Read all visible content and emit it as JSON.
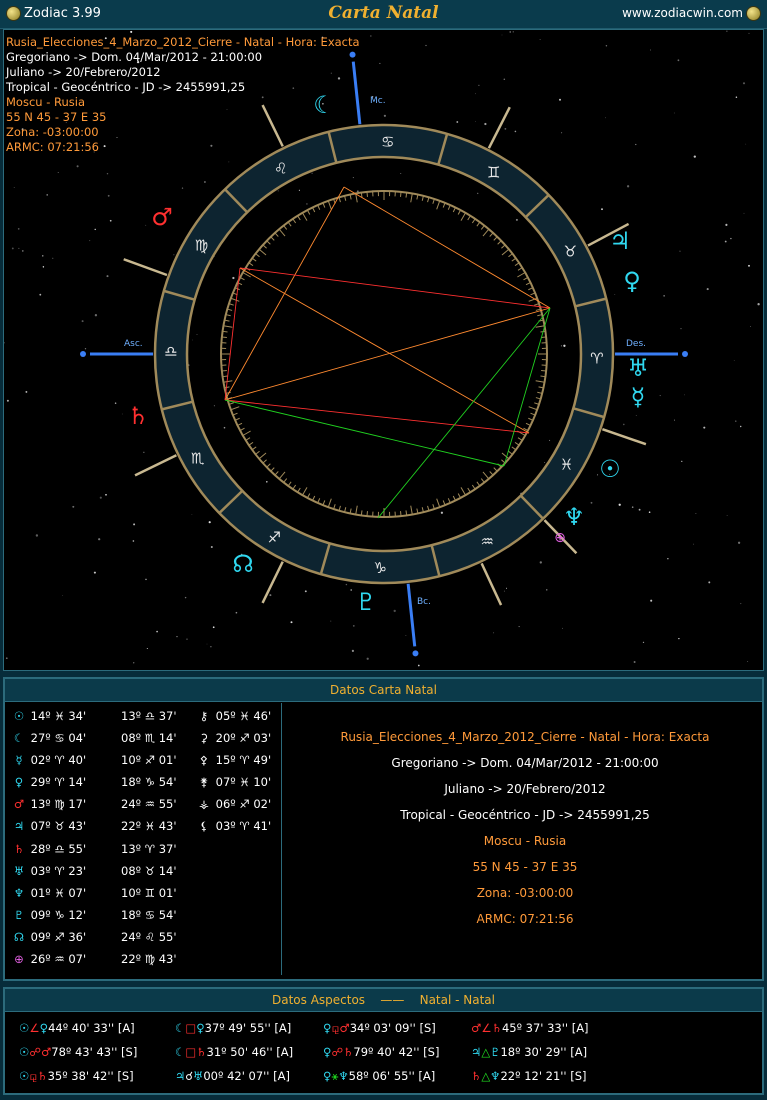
{
  "titlebar": {
    "app_name": "Zodiac 3.99",
    "title": "Carta Natal",
    "website": "www.zodiacwin.com"
  },
  "chart_info": {
    "lines": [
      {
        "text": "Rusia_Elecciones_4_Marzo_2012_Cierre - Natal - Hora: Exacta",
        "color": "#ff9a3a"
      },
      {
        "text": "Gregoriano -> Dom. 04/Mar/2012 - 21:00:00",
        "color": "#ffffff"
      },
      {
        "text": "Juliano -> 20/Febrero/2012",
        "color": "#ffffff"
      },
      {
        "text": "Tropical - Geocéntrico - JD -> 2455991,25",
        "color": "#ffffff"
      },
      {
        "text": "Moscu - Rusia",
        "color": "#ff9a3a"
      },
      {
        "text": "55 N 45 - 37 E 35",
        "color": "#ff9a3a"
      },
      {
        "text": "Zona: -03:00:00",
        "color": "#ff9a3a"
      },
      {
        "text": "ARMC: 07:21:56",
        "color": "#ff9a3a"
      }
    ]
  },
  "wheel": {
    "axis_labels": {
      "asc": "Asc.",
      "des": "Des.",
      "mc": "Mc.",
      "ic": "Bc."
    },
    "signs": [
      {
        "name": "aries",
        "glyph": "♈"
      },
      {
        "name": "taurus",
        "glyph": "♉"
      },
      {
        "name": "gemini",
        "glyph": "♊"
      },
      {
        "name": "cancer",
        "glyph": "♋"
      },
      {
        "name": "leo",
        "glyph": "♌"
      },
      {
        "name": "virgo",
        "glyph": "♍"
      },
      {
        "name": "libra",
        "glyph": "♎"
      },
      {
        "name": "scorpio",
        "glyph": "♏"
      },
      {
        "name": "sagittarius",
        "glyph": "♐"
      },
      {
        "name": "capricorn",
        "glyph": "♑"
      },
      {
        "name": "aquarius",
        "glyph": "♒"
      },
      {
        "name": "pisces",
        "glyph": "♓"
      }
    ],
    "planets": [
      {
        "name": "moon",
        "glyph": "☾",
        "color": "#30d8f0"
      },
      {
        "name": "jupiter",
        "glyph": "♃",
        "color": "#30d8f0"
      },
      {
        "name": "venus",
        "glyph": "♀",
        "color": "#30d8f0"
      },
      {
        "name": "uranus",
        "glyph": "♅",
        "color": "#30d8f0"
      },
      {
        "name": "mercury",
        "glyph": "☿",
        "color": "#30d8f0"
      },
      {
        "name": "sun",
        "glyph": "☉",
        "color": "#30d8f0"
      },
      {
        "name": "neptune",
        "glyph": "♆",
        "color": "#30d8f0"
      },
      {
        "name": "part-of-fortune",
        "glyph": "⊕",
        "color": "#e060e0"
      },
      {
        "name": "pluto",
        "glyph": "♇",
        "color": "#30d8f0"
      },
      {
        "name": "north-node",
        "glyph": "☊",
        "color": "#30d8f0"
      },
      {
        "name": "saturn",
        "glyph": "♄",
        "color": "#ff3030"
      },
      {
        "name": "mars",
        "glyph": "♂",
        "color": "#ff3030"
      }
    ]
  },
  "datos_carta": {
    "title": "Datos Carta Natal",
    "positions": [
      [
        {
          "g": "☉",
          "c": "#30d8f0",
          "deg": "14º",
          "s": "♓",
          "min": "34'"
        },
        {
          "g": "",
          "c": "",
          "deg": "13º",
          "s": "♎",
          "min": "37'"
        },
        {
          "g": "⚷",
          "c": "#ffffff",
          "deg": "05º",
          "s": "♓",
          "min": "46'"
        }
      ],
      [
        {
          "g": "☾",
          "c": "#30d8f0",
          "deg": "27º",
          "s": "♋",
          "min": "04'"
        },
        {
          "g": "",
          "c": "",
          "deg": "08º",
          "s": "♏",
          "min": "14'"
        },
        {
          "g": "⚳",
          "c": "#ffffff",
          "deg": "20º",
          "s": "♐",
          "min": "03'"
        }
      ],
      [
        {
          "g": "☿",
          "c": "#30d8f0",
          "deg": "02º",
          "s": "♈",
          "min": "40'"
        },
        {
          "g": "",
          "c": "",
          "deg": "10º",
          "s": "♐",
          "min": "01'"
        },
        {
          "g": "⚴",
          "c": "#ffffff",
          "deg": "15º",
          "s": "♈",
          "min": "49'"
        }
      ],
      [
        {
          "g": "♀",
          "c": "#30d8f0",
          "deg": "29º",
          "s": "♈",
          "min": "14'"
        },
        {
          "g": "",
          "c": "",
          "deg": "18º",
          "s": "♑",
          "min": "54'"
        },
        {
          "g": "⚵",
          "c": "#ffffff",
          "deg": "07º",
          "s": "♓",
          "min": "10'"
        }
      ],
      [
        {
          "g": "♂",
          "c": "#ff3030",
          "deg": "13º",
          "s": "♍",
          "min": "17'"
        },
        {
          "g": "",
          "c": "",
          "deg": "24º",
          "s": "♒",
          "min": "55'"
        },
        {
          "g": "⚶",
          "c": "#ffffff",
          "deg": "06º",
          "s": "♐",
          "min": "02'"
        }
      ],
      [
        {
          "g": "♃",
          "c": "#30d8f0",
          "deg": "07º",
          "s": "♉",
          "min": "43'"
        },
        {
          "g": "",
          "c": "",
          "deg": "22º",
          "s": "♓",
          "min": "43'"
        },
        {
          "g": "⚸",
          "c": "#ffffff",
          "deg": "03º",
          "s": "♈",
          "min": "41'"
        }
      ],
      [
        {
          "g": "♄",
          "c": "#ff3030",
          "deg": "28º",
          "s": "♎",
          "min": "55'"
        },
        {
          "g": "",
          "c": "",
          "deg": "13º",
          "s": "♈",
          "min": "37'"
        }
      ],
      [
        {
          "g": "♅",
          "c": "#30d8f0",
          "deg": "03º",
          "s": "♈",
          "min": "23'"
        },
        {
          "g": "",
          "c": "",
          "deg": "08º",
          "s": "♉",
          "min": "14'"
        }
      ],
      [
        {
          "g": "♆",
          "c": "#30d8f0",
          "deg": "01º",
          "s": "♓",
          "min": "07'"
        },
        {
          "g": "",
          "c": "",
          "deg": "10º",
          "s": "♊",
          "min": "01'"
        }
      ],
      [
        {
          "g": "♇",
          "c": "#30d8f0",
          "deg": "09º",
          "s": "♑",
          "min": "12'"
        },
        {
          "g": "",
          "c": "",
          "deg": "18º",
          "s": "♋",
          "min": "54'"
        }
      ],
      [
        {
          "g": "☊",
          "c": "#30d8f0",
          "deg": "09º",
          "s": "♐",
          "min": "36'"
        },
        {
          "g": "",
          "c": "",
          "deg": "24º",
          "s": "♌",
          "min": "55'"
        }
      ],
      [
        {
          "g": "⊕",
          "c": "#e060e0",
          "deg": "26º",
          "s": "♒",
          "min": "07'"
        },
        {
          "g": "",
          "c": "",
          "deg": "22º",
          "s": "♍",
          "min": "43'"
        }
      ]
    ],
    "summary": [
      {
        "text": "Rusia_Elecciones_4_Marzo_2012_Cierre - Natal - Hora: Exacta",
        "color": "#ff9a3a"
      },
      {
        "text": "Gregoriano -> Dom. 04/Mar/2012 - 21:00:00",
        "color": "#ffffff"
      },
      {
        "text": "Juliano -> 20/Febrero/2012",
        "color": "#ffffff"
      },
      {
        "text": "Tropical - Geocéntrico - JD -> 2455991,25",
        "color": "#ffffff"
      },
      {
        "text": "Moscu - Rusia",
        "color": "#ff9a3a"
      },
      {
        "text": "55 N 45 - 37 E 35",
        "color": "#ff9a3a"
      },
      {
        "text": "Zona: -03:00:00",
        "color": "#ff9a3a"
      },
      {
        "text": "ARMC: 07:21:56",
        "color": "#ff9a3a"
      }
    ]
  },
  "datos_aspectos": {
    "title": "Datos Aspectos",
    "separator": "——",
    "subtitle": "Natal - Natal",
    "aspects": [
      [
        {
          "p1": "☉",
          "c1": "#30d8f0",
          "a": "∠",
          "ac": "#ff3030",
          "p2": "♀",
          "c2": "#30d8f0",
          "val": "44º 40' 33'' [A]"
        },
        {
          "p1": "☾",
          "c1": "#30d8f0",
          "a": "□",
          "ac": "#ff3030",
          "p2": "♀",
          "c2": "#30d8f0",
          "val": "37º 49' 55'' [A]"
        },
        {
          "p1": "♀",
          "c1": "#30d8f0",
          "a": "⚼",
          "ac": "#ff3030",
          "p2": "♂",
          "c2": "#ff3030",
          "val": "34º 03' 09'' [S]"
        },
        {
          "p1": "♂",
          "c1": "#ff3030",
          "a": "∠",
          "ac": "#ff3030",
          "p2": "♄",
          "c2": "#ff3030",
          "val": "45º 37' 33'' [A]"
        }
      ],
      [
        {
          "p1": "☉",
          "c1": "#30d8f0",
          "a": "☍",
          "ac": "#ff3030",
          "p2": "♂",
          "c2": "#ff3030",
          "val": "78º 43' 43'' [S]"
        },
        {
          "p1": "☾",
          "c1": "#30d8f0",
          "a": "□",
          "ac": "#ff3030",
          "p2": "♄",
          "c2": "#ff3030",
          "val": "31º 50' 46'' [A]"
        },
        {
          "p1": "♀",
          "c1": "#30d8f0",
          "a": "☍",
          "ac": "#ff3030",
          "p2": "♄",
          "c2": "#ff3030",
          "val": "79º 40' 42'' [S]"
        },
        {
          "p1": "♃",
          "c1": "#30d8f0",
          "a": "△",
          "ac": "#20e020",
          "p2": "♇",
          "c2": "#30d8f0",
          "val": "18º 30' 29'' [A]"
        }
      ],
      [
        {
          "p1": "☉",
          "c1": "#30d8f0",
          "a": "⚼",
          "ac": "#ff3030",
          "p2": "♄",
          "c2": "#ff3030",
          "val": "35º 38' 42'' [S]"
        },
        {
          "p1": "♃",
          "c1": "#30d8f0",
          "a": "☌",
          "ac": "#ffffff",
          "p2": "♅",
          "c2": "#30d8f0",
          "val": "00º 42' 07'' [A]"
        },
        {
          "p1": "♀",
          "c1": "#30d8f0",
          "a": "⚹",
          "ac": "#20e020",
          "p2": "♆",
          "c2": "#30d8f0",
          "val": "58º 06' 55'' [A]"
        },
        {
          "p1": "♄",
          "c1": "#ff3030",
          "a": "△",
          "ac": "#20e020",
          "p2": "♆",
          "c2": "#30d8f0",
          "val": "22º 12' 21'' [S]"
        }
      ]
    ]
  }
}
